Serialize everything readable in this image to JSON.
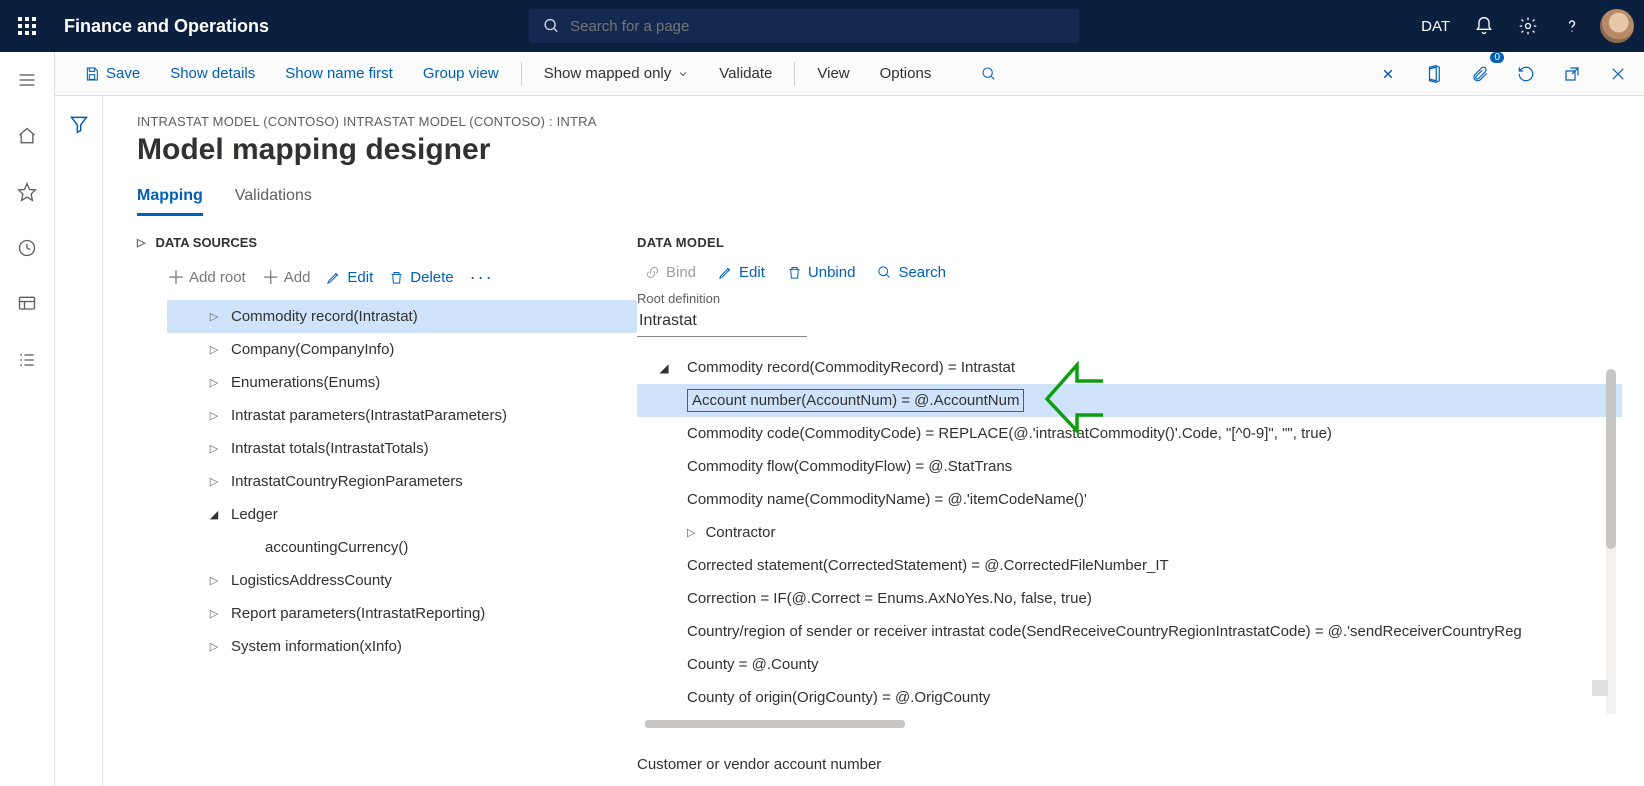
{
  "topbar": {
    "brand": "Finance and Operations",
    "search_placeholder": "Search for a page",
    "company": "DAT"
  },
  "cmdbar": {
    "save": "Save",
    "show_details": "Show details",
    "show_name_first": "Show name first",
    "group_view": "Group view",
    "show_mapped_only": "Show mapped only",
    "validate": "Validate",
    "view": "View",
    "options": "Options",
    "badge_count": "0"
  },
  "page": {
    "crumb": "INTRASTAT MODEL (CONTOSO) INTRASTAT MODEL (CONTOSO) : INTRA",
    "title": "Model mapping designer",
    "tabs": {
      "mapping": "Mapping",
      "validations": "Validations"
    }
  },
  "datasources": {
    "header": "DATA SOURCES",
    "toolbar": {
      "add_root": "Add root",
      "add": "Add",
      "edit": "Edit",
      "delete": "Delete"
    },
    "items": [
      {
        "label": "Commodity record(Intrastat)",
        "expandable": true,
        "selected": true
      },
      {
        "label": "Company(CompanyInfo)",
        "expandable": true
      },
      {
        "label": "Enumerations(Enums)",
        "expandable": true
      },
      {
        "label": "Intrastat parameters(IntrastatParameters)",
        "expandable": true
      },
      {
        "label": "Intrastat totals(IntrastatTotals)",
        "expandable": true
      },
      {
        "label": "IntrastatCountryRegionParameters",
        "expandable": true
      },
      {
        "label": "Ledger",
        "expandable": true,
        "expanded": true
      },
      {
        "label": "accountingCurrency()",
        "indent": 2
      },
      {
        "label": "LogisticsAddressCounty",
        "expandable": true
      },
      {
        "label": "Report parameters(IntrastatReporting)",
        "expandable": true
      },
      {
        "label": "System information(xInfo)",
        "expandable": true
      }
    ]
  },
  "datamodel": {
    "header": "DATA MODEL",
    "toolbar": {
      "bind": "Bind",
      "edit": "Edit",
      "unbind": "Unbind",
      "search": "Search"
    },
    "root_def_label": "Root definition",
    "root_def_value": "Intrastat",
    "root_row": "Commodity record(CommodityRecord) = Intrastat",
    "rows": [
      {
        "text": "Account number(AccountNum) = @.AccountNum",
        "selected": true
      },
      {
        "text": "Commodity code(CommodityCode) = REPLACE(@.'intrastatCommodity()'.Code, \"[^0-9]\", \"\", true)"
      },
      {
        "text": "Commodity flow(CommodityFlow) = @.StatTrans"
      },
      {
        "text": "Commodity name(CommodityName) = @.'itemCodeName()'"
      },
      {
        "text": "Contractor",
        "twisty": true
      },
      {
        "text": "Corrected statement(CorrectedStatement) = @.CorrectedFileNumber_IT"
      },
      {
        "text": "Correction = IF(@.Correct = Enums.AxNoYes.No, false, true)"
      },
      {
        "text": "Country/region of sender or receiver intrastat code(SendReceiveCountryRegionIntrastatCode) = @.'sendReceiverCountryReg"
      },
      {
        "text": "County = @.County"
      },
      {
        "text": "County of origin(OrigCounty) = @.OrigCounty"
      }
    ],
    "status": "Customer or vendor account number"
  }
}
